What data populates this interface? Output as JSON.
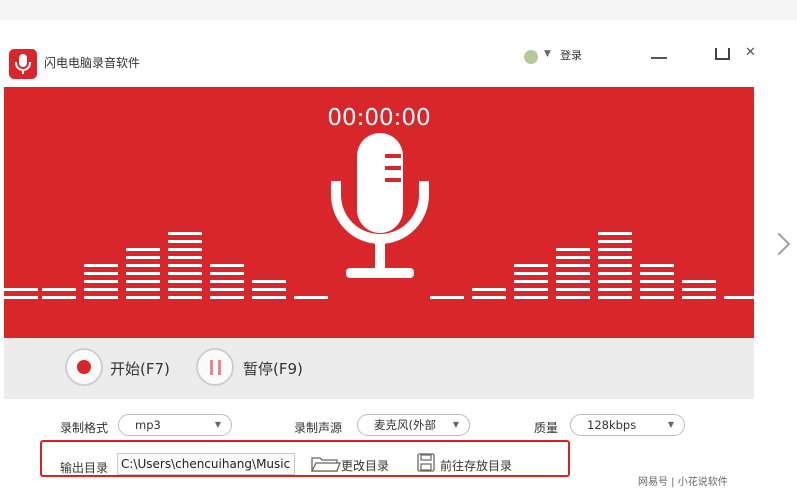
{
  "app": {
    "title": "闪电电脑录音软件",
    "login_label": "登录"
  },
  "recorder": {
    "timer": "00:00:00",
    "equalizer_levels": [
      2,
      2,
      5,
      7,
      9,
      5,
      3,
      1,
      1,
      2,
      5,
      7,
      9,
      5,
      3,
      1
    ]
  },
  "controls": {
    "start_label": "开始(F7)",
    "pause_label": "暂停(F9)"
  },
  "options": {
    "format_label": "录制格式",
    "format_value": "mp3",
    "source_label": "录制声源",
    "source_value": "麦克风(外部",
    "quality_label": "质量",
    "quality_value": "128kbps"
  },
  "output": {
    "label": "输出目录",
    "path": "C:\\Users\\chencuihang\\Music",
    "change_dir_label": "更改目录",
    "open_dir_label": "前往存放目录"
  },
  "watermark": {
    "text": "网易号 | 小花说软件"
  },
  "colors": {
    "accent": "#d9262a",
    "highlight_border": "#e02020"
  }
}
